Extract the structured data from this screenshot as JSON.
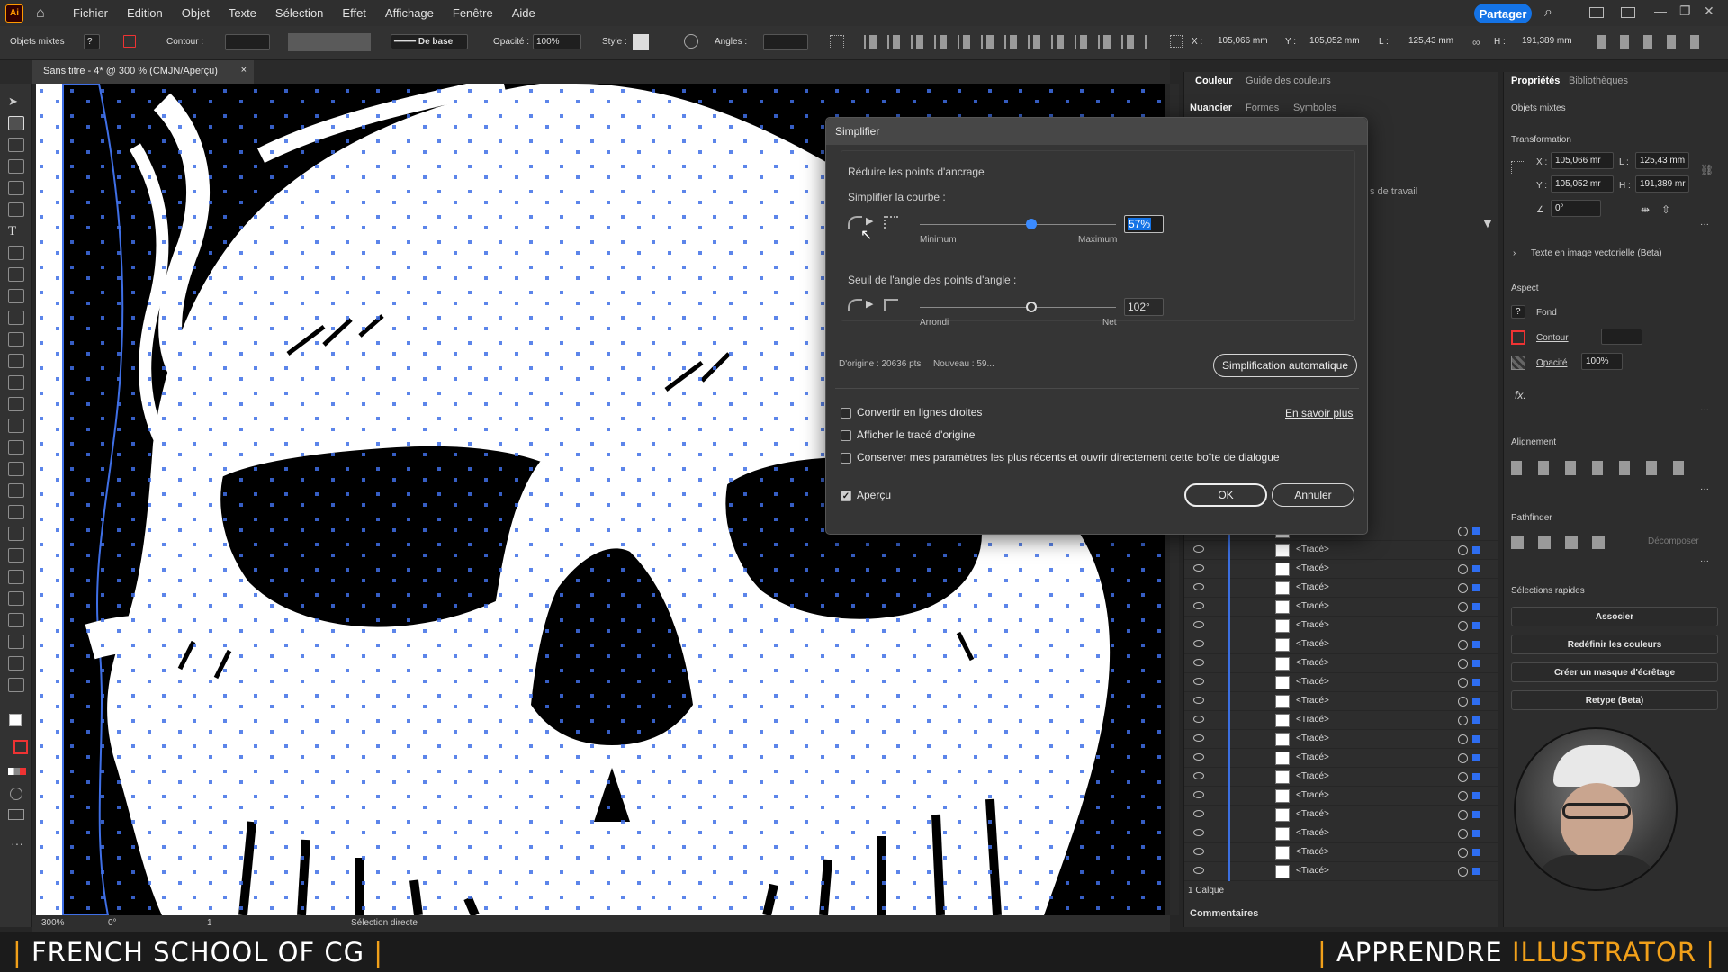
{
  "app": {
    "logo": "Ai"
  },
  "menu": [
    "Fichier",
    "Edition",
    "Objet",
    "Texte",
    "Sélection",
    "Effet",
    "Affichage",
    "Fenêtre",
    "Aide"
  ],
  "topbar": {
    "share": "Partager"
  },
  "control": {
    "mixed": "Objets mixtes",
    "question": "?",
    "contour_label": "Contour :",
    "stroke_style": "De base",
    "opacity_label": "Opacité :",
    "opacity_value": "100%",
    "style_label": "Style :",
    "angles_label": "Angles :",
    "x_label": "X :",
    "x_value": "105,066 mm",
    "y_label": "Y :",
    "y_value": "105,052 mm",
    "l_label": "L :",
    "l_value": "125,43 mm",
    "h_label": "H :",
    "h_value": "191,389 mm"
  },
  "document_tab": {
    "title": "Sans titre - 4* @ 300 % (CMJN/Aperçu)",
    "close": "×"
  },
  "status": {
    "zoom": "300%",
    "angle": "0°",
    "page": "1",
    "tool": "Sélection directe"
  },
  "mid_panel": {
    "tabs_row1": [
      "Couleur",
      "Guide des couleurs"
    ],
    "tabs_row2": [
      "Nuancier",
      "Formes",
      "Symboles"
    ],
    "hidden_tab": "s de travail",
    "layer_label": "<Tracé>",
    "layers_footer": "1 Calque",
    "comments": "Commentaires"
  },
  "right_panel": {
    "tabs": [
      "Propriétés",
      "Bibliothèques"
    ],
    "mixed": "Objets mixtes",
    "transform_title": "Transformation",
    "x_label": "X :",
    "x_value": "105,066 mr",
    "y_label": "Y :",
    "y_value": "105,052 mr",
    "l_label": "L :",
    "l_value": "125,43 mm",
    "h_label": "H :",
    "h_value": "191,389 mr",
    "angle_value": "0°",
    "vector_text": "Texte en image vectorielle (Beta)",
    "aspect_title": "Aspect",
    "fill": "Fond",
    "stroke": "Contour",
    "opacity": "Opacité",
    "opacity_value": "100%",
    "fx": "fx.",
    "align_title": "Alignement",
    "pathfinder_title": "Pathfinder",
    "decompose": "Décomposer",
    "quick_title": "Sélections rapides",
    "buttons": [
      "Associer",
      "Redéfinir les couleurs",
      "Créer un masque d'écrêtage",
      "Retype (Beta)"
    ]
  },
  "dialog": {
    "title": "Simplifier",
    "section": "Réduire les points d'ancrage",
    "curve_label": "Simplifier la courbe :",
    "curve_min": "Minimum",
    "curve_max": "Maximum",
    "curve_value": "57%",
    "curve_fraction": 0.57,
    "angle_label": "Seuil de l'angle des points d'angle :",
    "angle_min": "Arrondi",
    "angle_max": "Net",
    "angle_value": "102°",
    "angle_fraction": 0.57,
    "origin": "D'origine : 20636 pts",
    "new": "Nouveau : 59...",
    "auto": "Simplification automatique",
    "learn_more": "En savoir plus",
    "opt1": "Convertir en lignes droites",
    "opt2": "Afficher le tracé d'origine",
    "opt3": "Conserver mes paramètres les plus récents et ouvrir directement cette boîte de dialogue",
    "preview": "Aperçu",
    "ok": "OK",
    "cancel": "Annuler"
  },
  "footer": {
    "left": "FRENCH SCHOOL OF CG",
    "right_1": "APPRENDRE",
    "right_2": "ILLUSTRATOR",
    "sep": "|"
  },
  "colors": {
    "accent_blue": "#1473e6",
    "path_blue": "#3f6fe6",
    "footer_orange": "#f1a01a"
  }
}
